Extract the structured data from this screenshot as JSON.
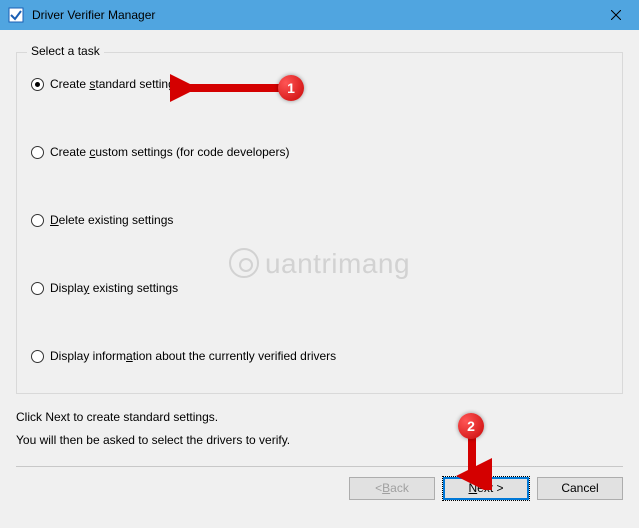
{
  "titlebar": {
    "title": "Driver Verifier Manager"
  },
  "group": {
    "legend": "Select a task",
    "options": [
      {
        "label_pre": "Create ",
        "label_ul": "s",
        "label_post": "tandard settings",
        "checked": true
      },
      {
        "label_pre": "Create ",
        "label_ul": "c",
        "label_post": "ustom settings (for code developers)",
        "checked": false
      },
      {
        "label_pre": "",
        "label_ul": "D",
        "label_post": "elete existing settings",
        "checked": false
      },
      {
        "label_pre": "Displa",
        "label_ul": "y",
        "label_post": " existing settings",
        "checked": false
      },
      {
        "label_pre": "Display inform",
        "label_ul": "a",
        "label_post": "tion about the currently verified drivers",
        "checked": false
      }
    ]
  },
  "info": {
    "line1": "Click Next to create standard settings.",
    "line2": "You will then be asked to select the drivers to verify."
  },
  "buttons": {
    "back_pre": "< ",
    "back_ul": "B",
    "back_post": "ack",
    "next_pre": "",
    "next_ul": "N",
    "next_post": "ext >",
    "cancel": "Cancel"
  },
  "annotations": {
    "badge1": "1",
    "badge2": "2"
  },
  "watermark": "uantrimang"
}
